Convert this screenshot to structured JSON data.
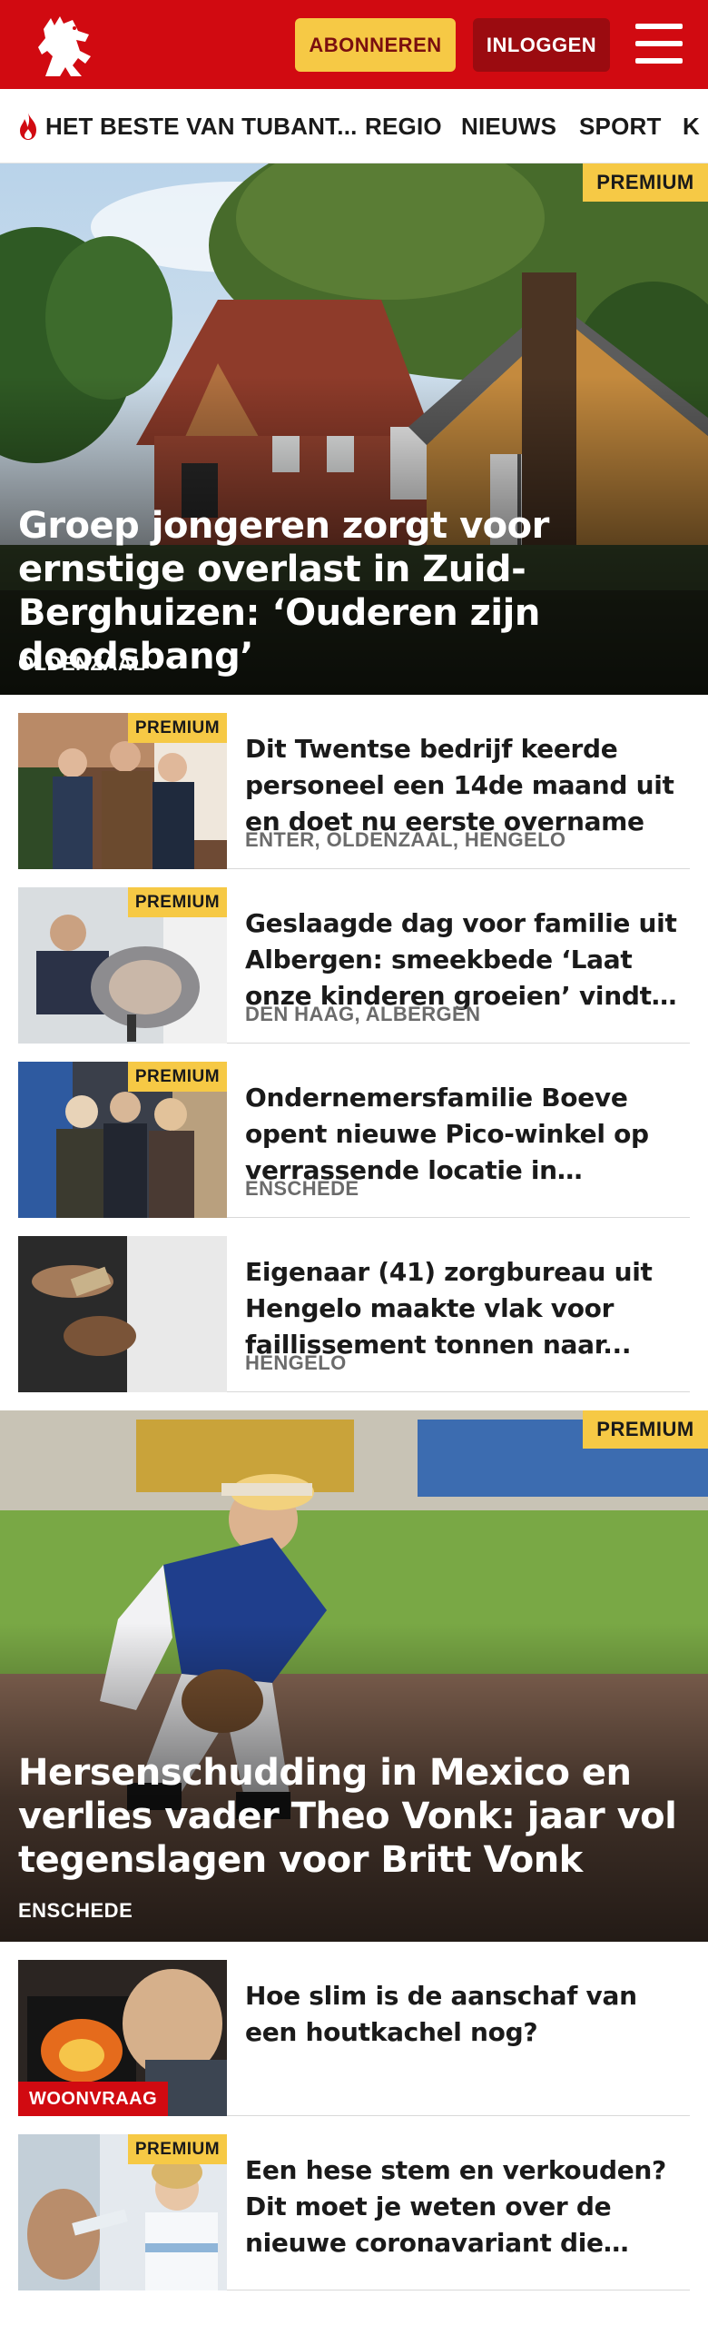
{
  "header": {
    "subscribe_label": "ABONNEREN",
    "login_label": "INLOGGEN",
    "brand_color": "#d10a11",
    "accent_color": "#f6c945"
  },
  "nav": {
    "items": [
      {
        "label": "HET BESTE VAN TUBANT...",
        "icon": "flame-icon"
      },
      {
        "label": "REGIO"
      },
      {
        "label": "NIEUWS"
      },
      {
        "label": "SPORT"
      },
      {
        "label": "K"
      }
    ]
  },
  "hero1": {
    "badge": "PREMIUM",
    "title": "Groep jongeren zorgt voor ernstige overlast in Zuid-Berghuizen: ‘Ouderen zijn doodsbang’",
    "location": "OLDENZAAL"
  },
  "list1": [
    {
      "badge": "PREMIUM",
      "title": "Dit Twentse bedrijf keerde personeel een 14de maand uit en doet nu eerste overname",
      "location": "ENTER, OLDENZAAL, HENGELO"
    },
    {
      "badge": "PREMIUM",
      "title": "Geslaagde dag voor familie uit Albergen: smeekbede ‘Laat onze kinderen groeien’ vindt gehoor in Den Haag",
      "location": "DEN HAAG, ALBERGEN"
    },
    {
      "badge": "PREMIUM",
      "title": "Ondernemersfamilie Boeve opent nieuwe Pico-winkel op verrassende locatie in Enschede",
      "location": "ENSCHEDE"
    },
    {
      "title": "Eigenaar (41) zorgbureau uit Hengelo maakte vlak voor faillissement tonnen naar...",
      "location": "HENGELO"
    }
  ],
  "hero2": {
    "badge": "PREMIUM",
    "title": "Hersenschudding in Mexico en verlies vader Theo Vonk: jaar vol tegenslagen voor Britt Vonk",
    "location": "ENSCHEDE"
  },
  "list2": [
    {
      "badge": "WOONVRAAG",
      "title": "Hoe slim is de aanschaf van een houtkachel nog?"
    },
    {
      "badge": "PREMIUM",
      "title": "Een hese stem en verkouden? Dit moet je weten over de nieuwe coronavariant die rondgaat"
    }
  ]
}
